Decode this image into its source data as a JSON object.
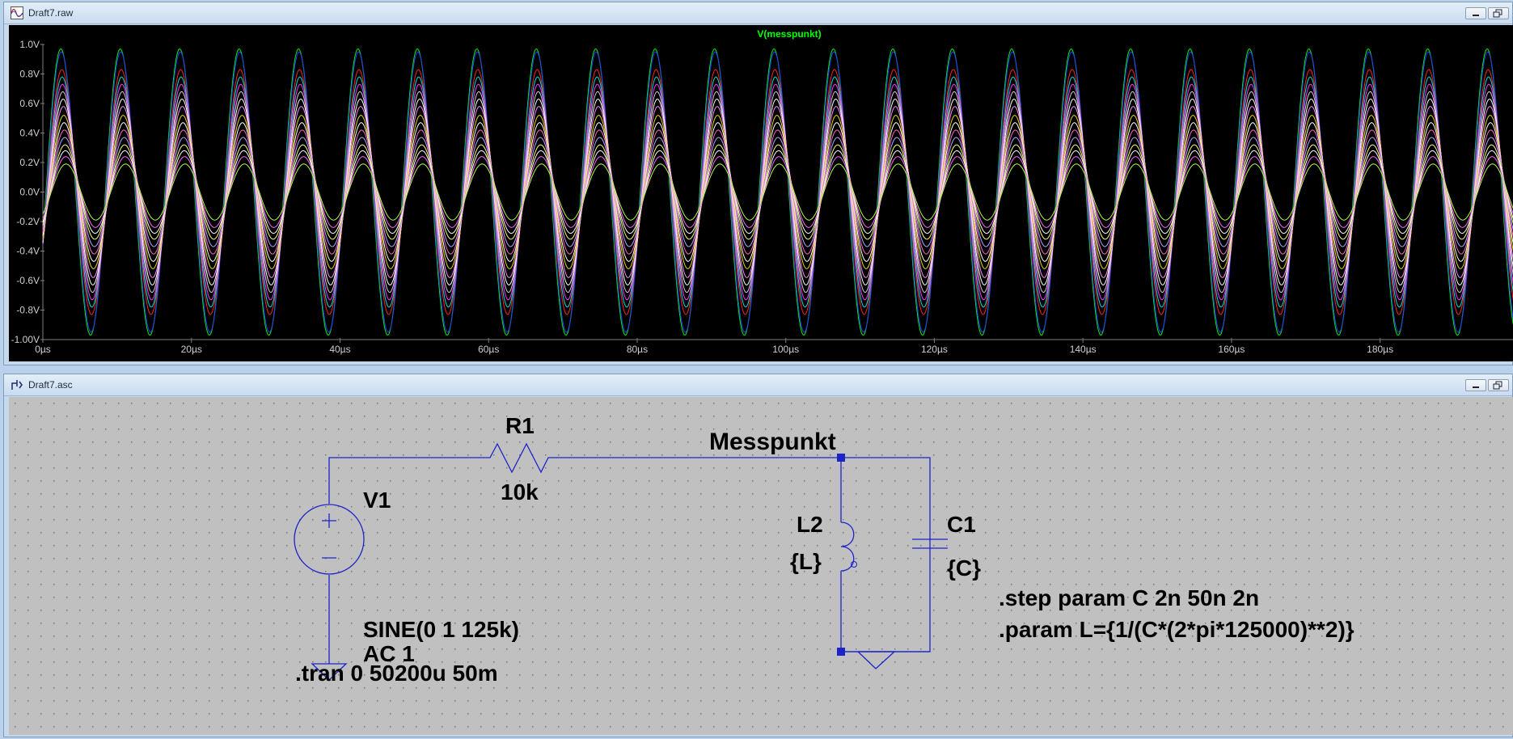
{
  "windows": {
    "plot": {
      "title": "Draft7.raw"
    },
    "schematic": {
      "title": "Draft7.asc"
    }
  },
  "chart_data": {
    "type": "line",
    "title": "V(messpunkt)",
    "xlabel": "",
    "ylabel": "",
    "x_unit": "µs",
    "y_unit": "V",
    "xlim": [
      0,
      198
    ],
    "ylim": [
      -1.0,
      1.0
    ],
    "x_ticks": [
      "0µs",
      "20µs",
      "40µs",
      "60µs",
      "80µs",
      "100µs",
      "120µs",
      "140µs",
      "160µs",
      "180µs"
    ],
    "y_ticks": [
      "1.0V",
      "0.8V",
      "0.6V",
      "0.4V",
      "0.2V",
      "0.0V",
      "-0.2V",
      "-0.4V",
      "-0.6V",
      "-0.8V",
      "-1.00V"
    ],
    "frequency_hz": 125000,
    "grid": false,
    "background": "#000000",
    "series": [
      {
        "amplitude": 0.97,
        "phase_offset_deg": 0,
        "color": "#00ee00"
      },
      {
        "amplitude": 0.95,
        "phase_offset_deg": 3,
        "color": "#2a3aff"
      },
      {
        "amplitude": 0.83,
        "phase_offset_deg": 6,
        "color": "#ff2020"
      },
      {
        "amplitude": 0.78,
        "phase_offset_deg": 8,
        "color": "#00dddd"
      },
      {
        "amplitude": 0.73,
        "phase_offset_deg": 10,
        "color": "#ff33ff"
      },
      {
        "amplitude": 0.68,
        "phase_offset_deg": 12,
        "color": "#cccccc"
      },
      {
        "amplitude": 0.63,
        "phase_offset_deg": 14,
        "color": "#ffffff"
      },
      {
        "amplitude": 0.58,
        "phase_offset_deg": 16,
        "color": "#ff88ff"
      },
      {
        "amplitude": 0.52,
        "phase_offset_deg": 18,
        "color": "#dddd00"
      },
      {
        "amplitude": 0.47,
        "phase_offset_deg": 20,
        "color": "#ffffff"
      },
      {
        "amplitude": 0.42,
        "phase_offset_deg": 22,
        "color": "#ff66cc"
      },
      {
        "amplitude": 0.37,
        "phase_offset_deg": 24,
        "color": "#aaaaff"
      },
      {
        "amplitude": 0.32,
        "phase_offset_deg": 26,
        "color": "#ffff66"
      },
      {
        "amplitude": 0.28,
        "phase_offset_deg": 28,
        "color": "#ffffff"
      },
      {
        "amplitude": 0.24,
        "phase_offset_deg": 30,
        "color": "#ff66ff"
      },
      {
        "amplitude": 0.19,
        "phase_offset_deg": 32,
        "color": "#aaff44"
      }
    ]
  },
  "schematic": {
    "net_color": "#1c23c8",
    "grid_dots": true,
    "labels": {
      "r1": "R1",
      "r1_value": "10k",
      "node": "Messpunkt",
      "v1": "V1",
      "l2": "L2",
      "l2_value": "{L}",
      "c1": "C1",
      "c1_value": "{C}",
      "source_line1": "SINE(0 1 125k)",
      "source_line2": "AC 1",
      "tran": ".tran 0 50200u 50m",
      "step": ".step param C 2n 50n 2n",
      "param": ".param L={1/(C*(2*pi*125000)**2)}"
    }
  }
}
